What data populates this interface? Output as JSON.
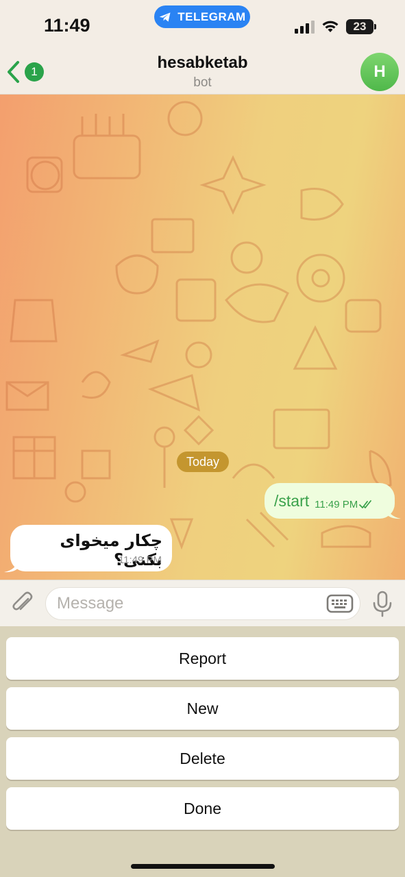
{
  "status_bar": {
    "time": "11:49",
    "app_pill": "TELEGRAM",
    "battery": "23"
  },
  "header": {
    "back_badge": "1",
    "title": "hesabketab",
    "subtitle": "bot",
    "avatar_letter": "H"
  },
  "chat": {
    "date_chip": "Today",
    "messages": [
      {
        "direction": "out",
        "text": "/start",
        "time": "11:49 PM",
        "status": "read"
      },
      {
        "direction": "in",
        "text": "چکار میخوای بکنی؟",
        "time": "11:49 PM"
      }
    ]
  },
  "composer": {
    "placeholder": "Message",
    "value": ""
  },
  "keyboard": {
    "buttons": [
      "Report",
      "New",
      "Delete",
      "Done"
    ]
  },
  "icons": {
    "back": "chevron-left-icon",
    "attach": "paperclip-icon",
    "keyboard": "keyboard-icon",
    "mic": "microphone-icon",
    "telegram": "telegram-plane-icon"
  },
  "colors": {
    "accent_green": "#2aa34a",
    "pill_blue": "#2a83f3",
    "date_chip": "#c4962f",
    "outgoing_bubble": "#effdde"
  }
}
